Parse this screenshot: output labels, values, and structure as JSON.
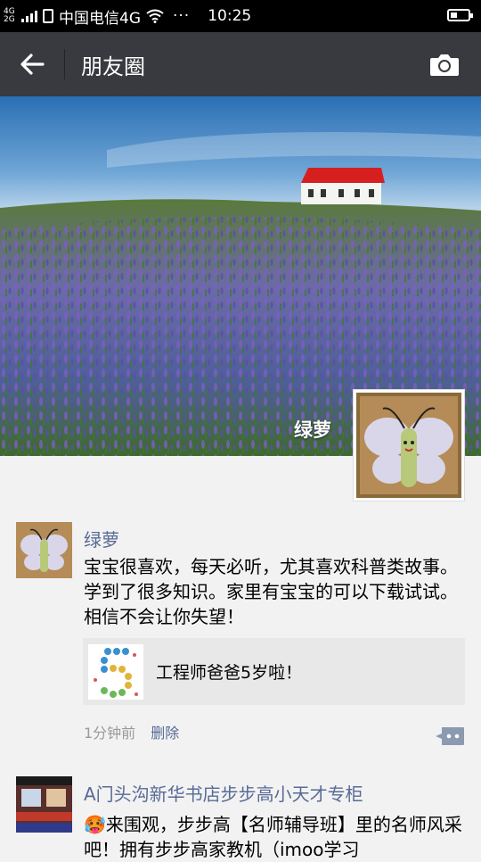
{
  "status_bar": {
    "network": "4G",
    "network2": "2G",
    "carrier": "中国电信4G",
    "more": "···",
    "time": "10:25",
    "battery_level": 0.4
  },
  "header": {
    "title": "朋友圈",
    "back_icon": "arrow-left-icon",
    "camera_icon": "camera-icon"
  },
  "cover": {
    "user_name": "绿萝"
  },
  "posts": [
    {
      "author": "绿萝",
      "text": "宝宝很喜欢，每天必听，尤其喜欢科普类故事。学到了很多知识。家里有宝宝的可以下载试试。相信不会让你失望！",
      "share": {
        "title": "工程师爸爸5岁啦！"
      },
      "time": "1分钟前",
      "delete_label": "删除"
    },
    {
      "author": "A门头沟新华书店步步高小天才专柜",
      "text": "🥵来围观，步步高【名师辅导班】里的名师风采吧！拥有步步高家教机（imoo学习"
    }
  ],
  "colors": {
    "titlebar": "#393a3f",
    "link": "#576b95",
    "background": "#f2f2f2"
  }
}
